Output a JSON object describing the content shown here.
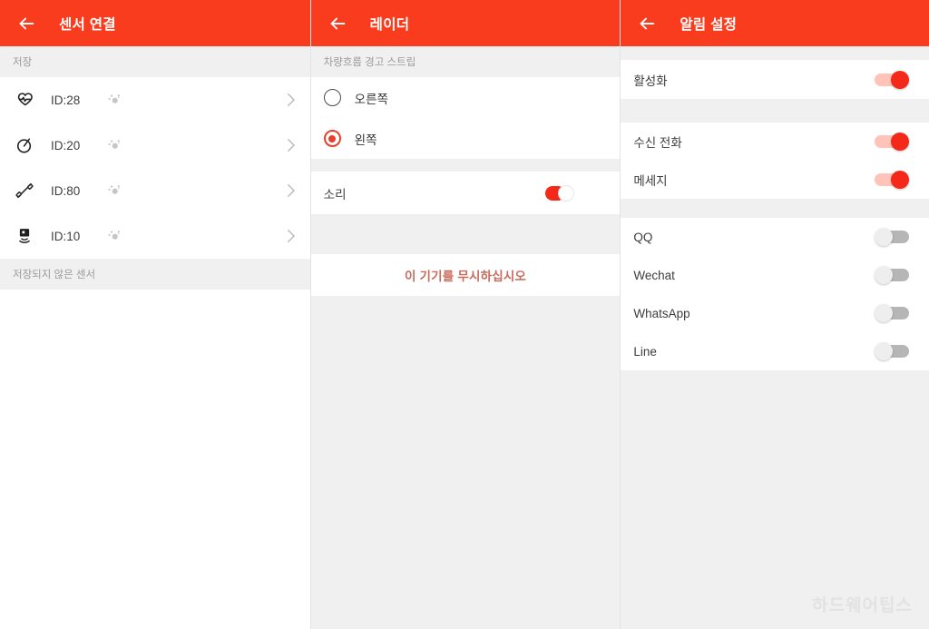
{
  "colors": {
    "appbar": "#f93c1e",
    "accent_red": "#f4291a",
    "notice_red": "#c86a5c",
    "page_bg": "#f0f0f0",
    "card_bg": "#ffffff",
    "switch_off_track": "#b6b6b6"
  },
  "panel_sensors": {
    "appbar": {
      "back_label": "back",
      "title": "센서 연결"
    },
    "section_saved_label": "저장",
    "sensors": [
      {
        "icon": "heart-rate-icon",
        "id_label": "ID:28",
        "signal_icon": "signal-node-icon",
        "chevron": "chevron-right-icon"
      },
      {
        "icon": "speedometer-icon",
        "id_label": "ID:20",
        "signal_icon": "signal-node-icon",
        "chevron": "chevron-right-icon"
      },
      {
        "icon": "dumbbell-icon",
        "id_label": "ID:80",
        "signal_icon": "signal-node-icon",
        "chevron": "chevron-right-icon"
      },
      {
        "icon": "sensor-broadcast-icon",
        "id_label": "ID:10",
        "signal_icon": "signal-node-icon",
        "chevron": "chevron-right-icon"
      }
    ],
    "section_unsaved_label": "저장되지 않은 센서"
  },
  "panel_radar": {
    "appbar": {
      "back_label": "back",
      "title": "레이더"
    },
    "section_label": "차량흐름 경고 스트립",
    "options": [
      {
        "label": "오른쪽",
        "selected": false
      },
      {
        "label": "왼쪽",
        "selected": true
      }
    ],
    "sound": {
      "label": "소리",
      "state": "on"
    },
    "notice": "이 기기를 무시하십시오"
  },
  "panel_alerts": {
    "appbar": {
      "back_label": "back",
      "title": "알림 설정"
    },
    "master": {
      "label": "활성화",
      "state": "on"
    },
    "group_calls": [
      {
        "label": "수신 전화",
        "state": "on"
      },
      {
        "label": "메세지",
        "state": "on"
      }
    ],
    "group_apps": [
      {
        "label": "QQ",
        "state": "off"
      },
      {
        "label": "Wechat",
        "state": "off"
      },
      {
        "label": "WhatsApp",
        "state": "off"
      },
      {
        "label": "Line",
        "state": "off"
      }
    ]
  },
  "watermark": {
    "text": "하드웨어팁스"
  }
}
